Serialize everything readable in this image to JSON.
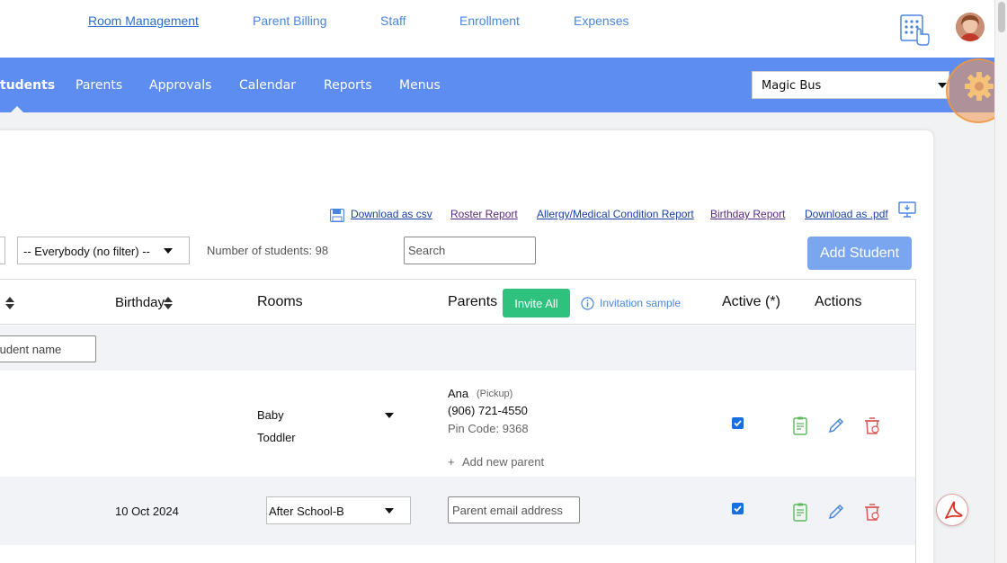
{
  "top_nav": {
    "links": [
      "Room Management",
      "Parent Billing",
      "Staff",
      "Enrollment",
      "Expenses"
    ]
  },
  "main_nav": {
    "items": [
      "tudents",
      "Parents",
      "Approvals",
      "Calendar",
      "Reports",
      "Menus"
    ],
    "school_select": "Magic Bus"
  },
  "downloads": {
    "csv": "Download as csv",
    "roster": "Roster Report",
    "allergy": "Allergy/Medical Condition Report",
    "birthday": "Birthday Report",
    "pdf": "Download as .pdf"
  },
  "filters": {
    "everybody": "-- Everybody (no filter) --",
    "count_label": "Number of students: 98",
    "search_placeholder": "Search",
    "add_student": "Add Student"
  },
  "table": {
    "headers": {
      "birthday": "Birthday",
      "rooms": "Rooms",
      "parents": "Parents",
      "invite_all": "Invite All",
      "invitation_sample": "Invitation sample",
      "active": "Active (*)",
      "actions": "Actions"
    },
    "name_filter_placeholder": "tudent name",
    "rows": [
      {
        "birthday": "",
        "rooms": [
          "Baby",
          "Toddler"
        ],
        "parent_name": "Ana",
        "parent_role": "(Pickup)",
        "parent_phone": "(906) 721-4550",
        "pin": "Pin Code: 9368",
        "add_parent": "Add new parent",
        "active": true
      },
      {
        "birthday": "10 Oct 2024",
        "room_select": "After School-B",
        "email_placeholder": "Parent email address",
        "active": true
      }
    ]
  },
  "colors": {
    "nav_blue": "#5e8df2",
    "link_blue": "#4a86e0",
    "green": "#2ec27e",
    "red": "#e05555"
  }
}
